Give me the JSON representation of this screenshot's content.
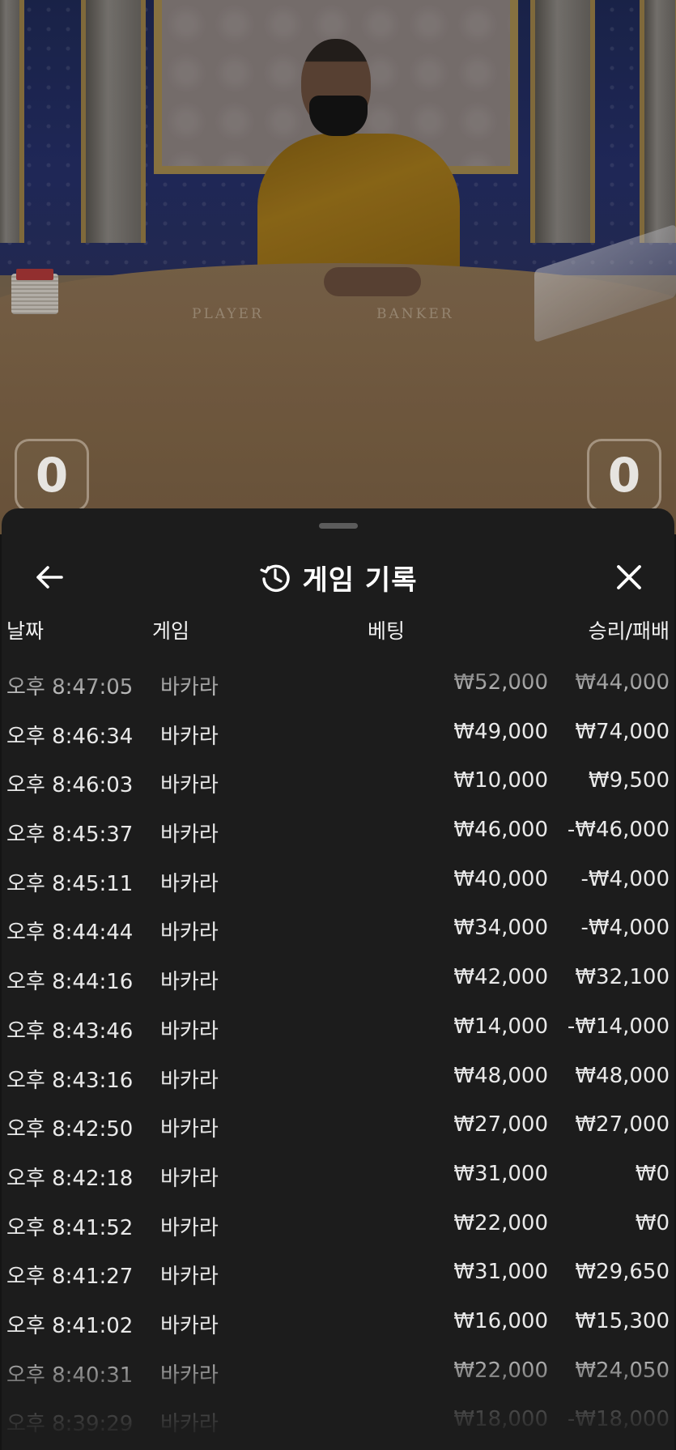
{
  "video": {
    "felt_player_label": "PLAYER",
    "felt_banker_label": "BANKER",
    "player_score": "0",
    "banker_score": "0"
  },
  "sheet": {
    "title": "게임 기록",
    "columns": {
      "date": "날짜",
      "game": "게임",
      "bet": "베팅",
      "win_loss": "승리/패배"
    },
    "rows": [
      {
        "time": "오후 8:47:05",
        "game": "바카라",
        "bet": "₩52,000",
        "result": "₩44,000"
      },
      {
        "time": "오후 8:46:34",
        "game": "바카라",
        "bet": "₩49,000",
        "result": "₩74,000"
      },
      {
        "time": "오후 8:46:03",
        "game": "바카라",
        "bet": "₩10,000",
        "result": "₩9,500"
      },
      {
        "time": "오후 8:45:37",
        "game": "바카라",
        "bet": "₩46,000",
        "result": "-₩46,000"
      },
      {
        "time": "오후 8:45:11",
        "game": "바카라",
        "bet": "₩40,000",
        "result": "-₩4,000"
      },
      {
        "time": "오후 8:44:44",
        "game": "바카라",
        "bet": "₩34,000",
        "result": "-₩4,000"
      },
      {
        "time": "오후 8:44:16",
        "game": "바카라",
        "bet": "₩42,000",
        "result": "₩32,100"
      },
      {
        "time": "오후 8:43:46",
        "game": "바카라",
        "bet": "₩14,000",
        "result": "-₩14,000"
      },
      {
        "time": "오후 8:43:16",
        "game": "바카라",
        "bet": "₩48,000",
        "result": "₩48,000"
      },
      {
        "time": "오후 8:42:50",
        "game": "바카라",
        "bet": "₩27,000",
        "result": "₩27,000"
      },
      {
        "time": "오후 8:42:18",
        "game": "바카라",
        "bet": "₩31,000",
        "result": "₩0"
      },
      {
        "time": "오후 8:41:52",
        "game": "바카라",
        "bet": "₩22,000",
        "result": "₩0"
      },
      {
        "time": "오후 8:41:27",
        "game": "바카라",
        "bet": "₩31,000",
        "result": "₩29,650"
      },
      {
        "time": "오후 8:41:02",
        "game": "바카라",
        "bet": "₩16,000",
        "result": "₩15,300"
      },
      {
        "time": "오후 8:40:31",
        "game": "바카라",
        "bet": "₩22,000",
        "result": "₩24,050"
      },
      {
        "time": "오후 8:39:29",
        "game": "바카라",
        "bet": "₩18,000",
        "result": "-₩18,000"
      }
    ]
  },
  "icons": {
    "back": "arrow-left-icon",
    "history": "history-icon",
    "close": "close-icon"
  },
  "colors": {
    "sheet_bg": "#1c1c1c",
    "text": "#e9e9e9",
    "title": "#ffffff"
  }
}
